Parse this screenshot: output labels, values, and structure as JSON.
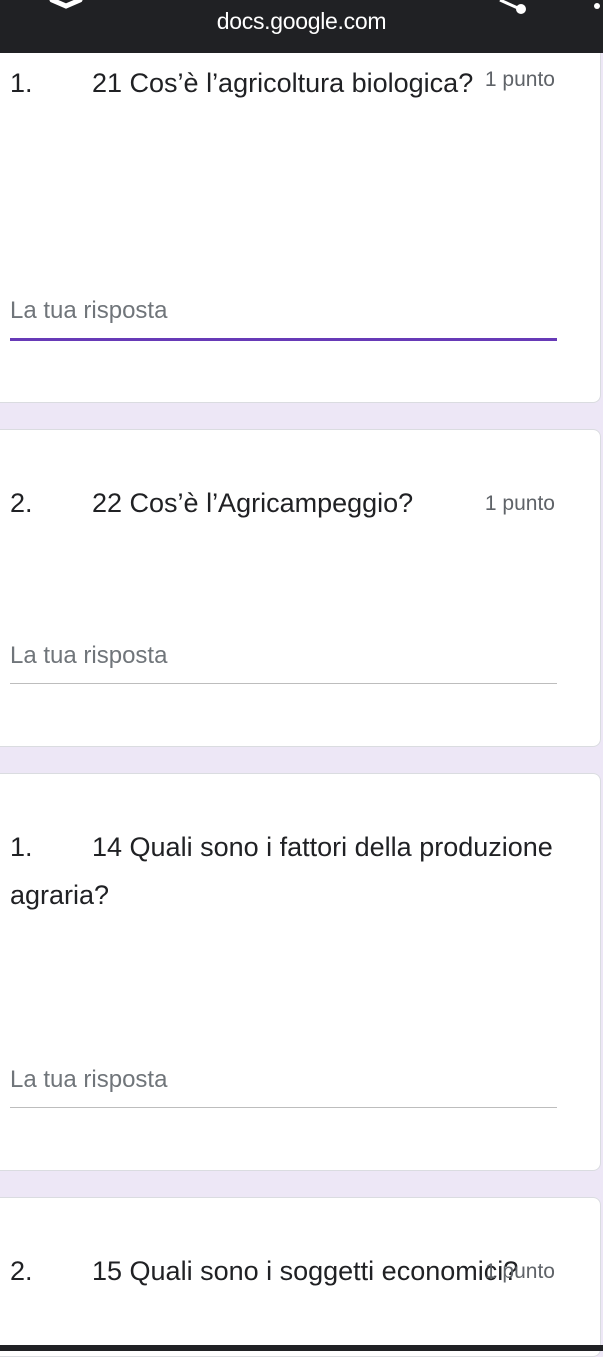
{
  "browser": {
    "url": "docs.google.com"
  },
  "questions": [
    {
      "number": "1.",
      "title": "21 Cos’è l’agricoltura biologica?",
      "points": "1 punto",
      "placeholder": "La tua risposta"
    },
    {
      "number": "2.",
      "title": "22 Cos’è l’Agricampeggio?",
      "points": "1 punto",
      "placeholder": "La tua risposta"
    },
    {
      "number": "1.",
      "title": "14 Quali sono i fattori della produzione agraria?",
      "points": "",
      "placeholder": "La tua risposta"
    },
    {
      "number": "2.",
      "title": "15 Quali sono i soggetti economici?",
      "points": "1 punto",
      "placeholder": ""
    }
  ],
  "colors": {
    "accent": "#673AB7",
    "page_background": "#EDE7F6",
    "browser_bar": "#202124"
  }
}
